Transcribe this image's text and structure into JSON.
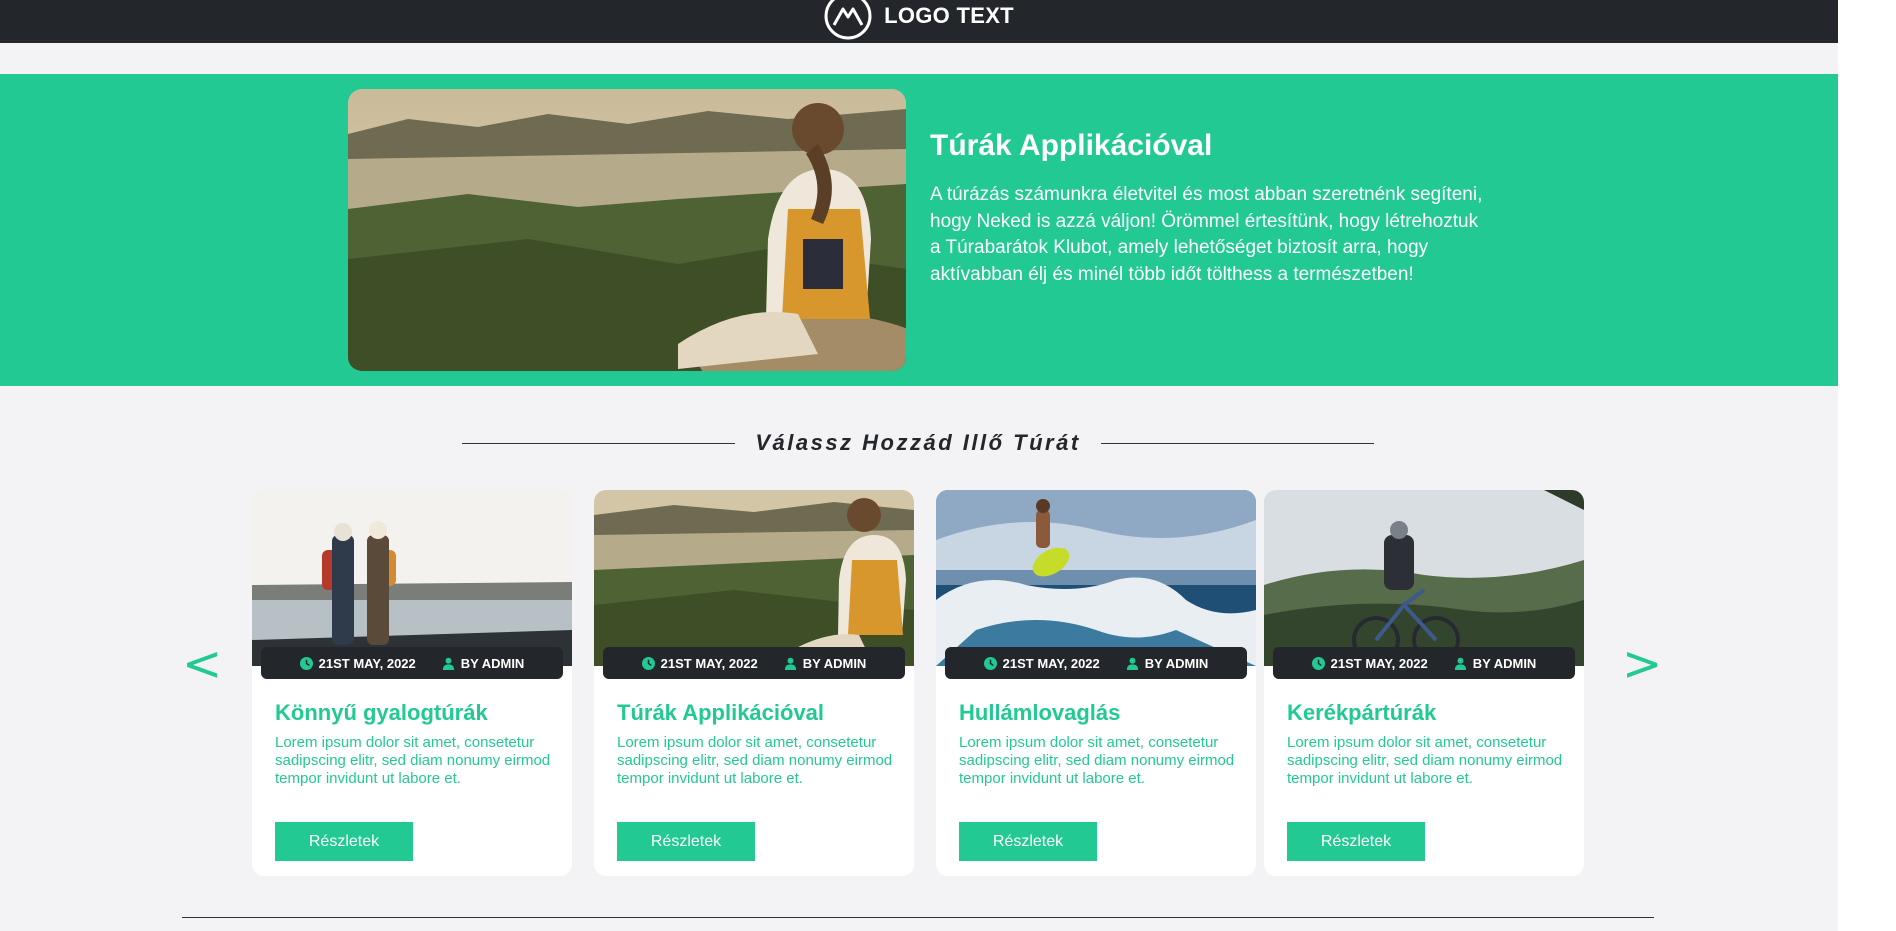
{
  "header": {
    "logo_text": "LOGO TEXT",
    "logo_icon": "mountain-logo-icon"
  },
  "hero": {
    "image": "hiker-woman-overlooking-bay",
    "title": "Túrák Applikációval",
    "text": "A túrázás számunkra életvitel és most abban szeretnénk segíteni, hogy Neked is azzá váljon! Örömmel értesítünk, hogy létrehoztuk a Túrabarátok Klubot, amely lehetőséget biztosít arra, hogy aktívabban élj és minél több időt tölthess a természetben!"
  },
  "section": {
    "title": "Válassz Hozzád Illő Túrát"
  },
  "carousel": {
    "prev": "<",
    "next": ">"
  },
  "cards": [
    {
      "image": "couple-hikers-lake",
      "date": "21ST MAY, 2022",
      "author": "BY ADMIN",
      "title": "Könnyű gyalogtúrák",
      "text": "Lorem ipsum dolor sit amet, consetetur sadipscing elitr, sed diam nonumy eirmod tempor invidunt ut labore et.",
      "button": "Részletek"
    },
    {
      "image": "hiker-woman-overlooking-bay",
      "date": "21ST MAY, 2022",
      "author": "BY ADMIN",
      "title": "Túrák Applikációval",
      "text": "Lorem ipsum dolor sit amet, consetetur sadipscing elitr, sed diam nonumy eirmod tempor invidunt ut labore et.",
      "button": "Részletek"
    },
    {
      "image": "surfer-on-wave",
      "date": "21ST MAY, 2022",
      "author": "BY ADMIN",
      "title": "Hullámlovaglás",
      "text": "Lorem ipsum dolor sit amet, consetetur sadipscing elitr, sed diam nonumy eirmod tempor invidunt ut labore et.",
      "button": "Részletek"
    },
    {
      "image": "mountain-biker-forest",
      "date": "21ST MAY, 2022",
      "author": "BY ADMIN",
      "title": "Kerékpártúrák",
      "text": "Lorem ipsum dolor sit amet, consetetur sadipscing elitr, sed diam nonumy eirmod tempor invidunt ut labore et.",
      "button": "Részletek"
    }
  ],
  "colors": {
    "accent": "#22c993",
    "dark": "#23262b",
    "background": "#f3f2f4"
  }
}
